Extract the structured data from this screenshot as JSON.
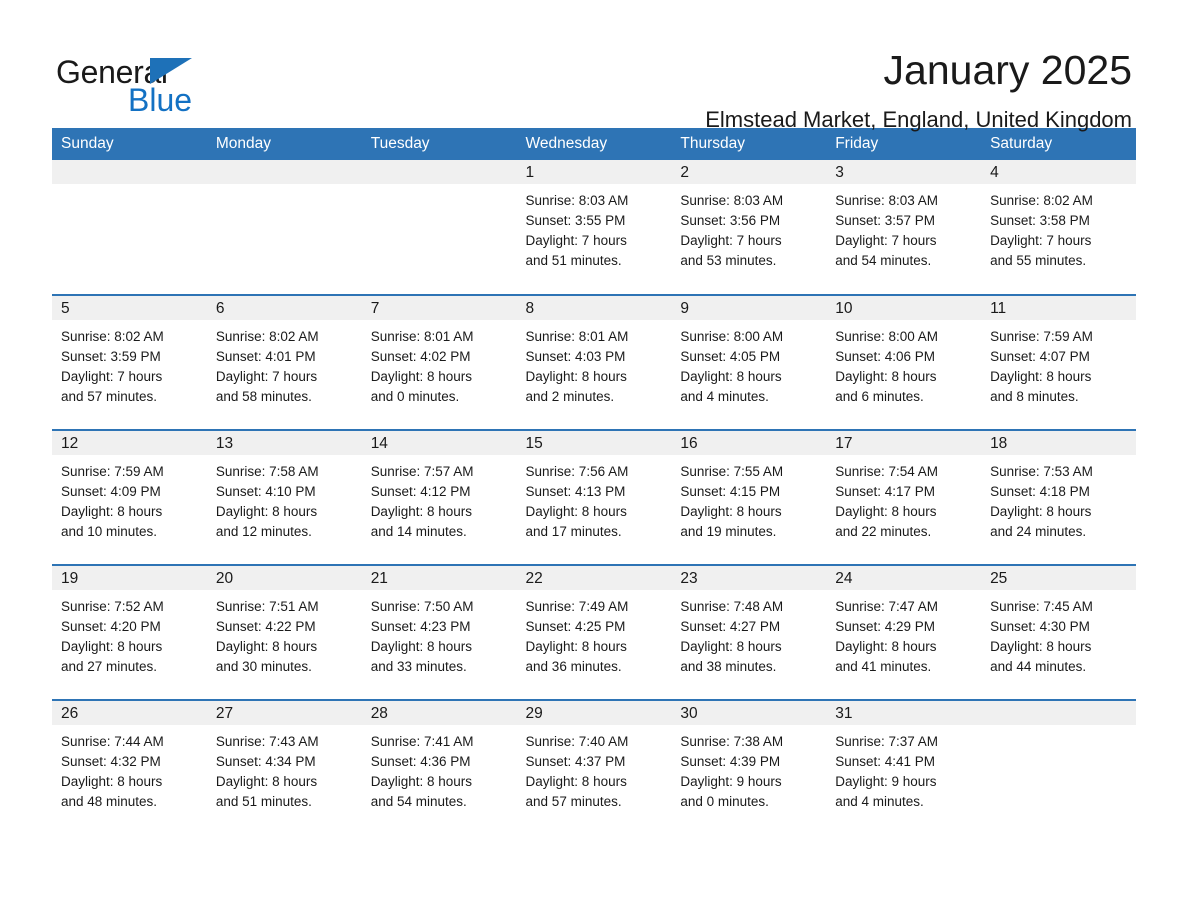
{
  "brand": {
    "name_part1": "General",
    "name_part2": "Blue",
    "triangle_icon": "triangle-icon",
    "accent_color": "#1371c3"
  },
  "header": {
    "title": "January 2025",
    "subtitle": "Elmstead Market, England, United Kingdom"
  },
  "theme": {
    "header_blue": "#2e74b5",
    "daynum_band": "#f0f0f0",
    "text": "#1a1a1a"
  },
  "calendar": {
    "columns": [
      "Sunday",
      "Monday",
      "Tuesday",
      "Wednesday",
      "Thursday",
      "Friday",
      "Saturday"
    ],
    "labels": {
      "sunrise": "Sunrise:",
      "sunset": "Sunset:",
      "daylight": "Daylight:"
    },
    "weeks": [
      [
        {
          "day": ""
        },
        {
          "day": ""
        },
        {
          "day": ""
        },
        {
          "day": "1",
          "sunrise": "Sunrise: 8:03 AM",
          "sunset": "Sunset: 3:55 PM",
          "daylight_line1": "Daylight: 7 hours",
          "daylight_line2": "and 51 minutes."
        },
        {
          "day": "2",
          "sunrise": "Sunrise: 8:03 AM",
          "sunset": "Sunset: 3:56 PM",
          "daylight_line1": "Daylight: 7 hours",
          "daylight_line2": "and 53 minutes."
        },
        {
          "day": "3",
          "sunrise": "Sunrise: 8:03 AM",
          "sunset": "Sunset: 3:57 PM",
          "daylight_line1": "Daylight: 7 hours",
          "daylight_line2": "and 54 minutes."
        },
        {
          "day": "4",
          "sunrise": "Sunrise: 8:02 AM",
          "sunset": "Sunset: 3:58 PM",
          "daylight_line1": "Daylight: 7 hours",
          "daylight_line2": "and 55 minutes."
        }
      ],
      [
        {
          "day": "5",
          "sunrise": "Sunrise: 8:02 AM",
          "sunset": "Sunset: 3:59 PM",
          "daylight_line1": "Daylight: 7 hours",
          "daylight_line2": "and 57 minutes."
        },
        {
          "day": "6",
          "sunrise": "Sunrise: 8:02 AM",
          "sunset": "Sunset: 4:01 PM",
          "daylight_line1": "Daylight: 7 hours",
          "daylight_line2": "and 58 minutes."
        },
        {
          "day": "7",
          "sunrise": "Sunrise: 8:01 AM",
          "sunset": "Sunset: 4:02 PM",
          "daylight_line1": "Daylight: 8 hours",
          "daylight_line2": "and 0 minutes."
        },
        {
          "day": "8",
          "sunrise": "Sunrise: 8:01 AM",
          "sunset": "Sunset: 4:03 PM",
          "daylight_line1": "Daylight: 8 hours",
          "daylight_line2": "and 2 minutes."
        },
        {
          "day": "9",
          "sunrise": "Sunrise: 8:00 AM",
          "sunset": "Sunset: 4:05 PM",
          "daylight_line1": "Daylight: 8 hours",
          "daylight_line2": "and 4 minutes."
        },
        {
          "day": "10",
          "sunrise": "Sunrise: 8:00 AM",
          "sunset": "Sunset: 4:06 PM",
          "daylight_line1": "Daylight: 8 hours",
          "daylight_line2": "and 6 minutes."
        },
        {
          "day": "11",
          "sunrise": "Sunrise: 7:59 AM",
          "sunset": "Sunset: 4:07 PM",
          "daylight_line1": "Daylight: 8 hours",
          "daylight_line2": "and 8 minutes."
        }
      ],
      [
        {
          "day": "12",
          "sunrise": "Sunrise: 7:59 AM",
          "sunset": "Sunset: 4:09 PM",
          "daylight_line1": "Daylight: 8 hours",
          "daylight_line2": "and 10 minutes."
        },
        {
          "day": "13",
          "sunrise": "Sunrise: 7:58 AM",
          "sunset": "Sunset: 4:10 PM",
          "daylight_line1": "Daylight: 8 hours",
          "daylight_line2": "and 12 minutes."
        },
        {
          "day": "14",
          "sunrise": "Sunrise: 7:57 AM",
          "sunset": "Sunset: 4:12 PM",
          "daylight_line1": "Daylight: 8 hours",
          "daylight_line2": "and 14 minutes."
        },
        {
          "day": "15",
          "sunrise": "Sunrise: 7:56 AM",
          "sunset": "Sunset: 4:13 PM",
          "daylight_line1": "Daylight: 8 hours",
          "daylight_line2": "and 17 minutes."
        },
        {
          "day": "16",
          "sunrise": "Sunrise: 7:55 AM",
          "sunset": "Sunset: 4:15 PM",
          "daylight_line1": "Daylight: 8 hours",
          "daylight_line2": "and 19 minutes."
        },
        {
          "day": "17",
          "sunrise": "Sunrise: 7:54 AM",
          "sunset": "Sunset: 4:17 PM",
          "daylight_line1": "Daylight: 8 hours",
          "daylight_line2": "and 22 minutes."
        },
        {
          "day": "18",
          "sunrise": "Sunrise: 7:53 AM",
          "sunset": "Sunset: 4:18 PM",
          "daylight_line1": "Daylight: 8 hours",
          "daylight_line2": "and 24 minutes."
        }
      ],
      [
        {
          "day": "19",
          "sunrise": "Sunrise: 7:52 AM",
          "sunset": "Sunset: 4:20 PM",
          "daylight_line1": "Daylight: 8 hours",
          "daylight_line2": "and 27 minutes."
        },
        {
          "day": "20",
          "sunrise": "Sunrise: 7:51 AM",
          "sunset": "Sunset: 4:22 PM",
          "daylight_line1": "Daylight: 8 hours",
          "daylight_line2": "and 30 minutes."
        },
        {
          "day": "21",
          "sunrise": "Sunrise: 7:50 AM",
          "sunset": "Sunset: 4:23 PM",
          "daylight_line1": "Daylight: 8 hours",
          "daylight_line2": "and 33 minutes."
        },
        {
          "day": "22",
          "sunrise": "Sunrise: 7:49 AM",
          "sunset": "Sunset: 4:25 PM",
          "daylight_line1": "Daylight: 8 hours",
          "daylight_line2": "and 36 minutes."
        },
        {
          "day": "23",
          "sunrise": "Sunrise: 7:48 AM",
          "sunset": "Sunset: 4:27 PM",
          "daylight_line1": "Daylight: 8 hours",
          "daylight_line2": "and 38 minutes."
        },
        {
          "day": "24",
          "sunrise": "Sunrise: 7:47 AM",
          "sunset": "Sunset: 4:29 PM",
          "daylight_line1": "Daylight: 8 hours",
          "daylight_line2": "and 41 minutes."
        },
        {
          "day": "25",
          "sunrise": "Sunrise: 7:45 AM",
          "sunset": "Sunset: 4:30 PM",
          "daylight_line1": "Daylight: 8 hours",
          "daylight_line2": "and 44 minutes."
        }
      ],
      [
        {
          "day": "26",
          "sunrise": "Sunrise: 7:44 AM",
          "sunset": "Sunset: 4:32 PM",
          "daylight_line1": "Daylight: 8 hours",
          "daylight_line2": "and 48 minutes."
        },
        {
          "day": "27",
          "sunrise": "Sunrise: 7:43 AM",
          "sunset": "Sunset: 4:34 PM",
          "daylight_line1": "Daylight: 8 hours",
          "daylight_line2": "and 51 minutes."
        },
        {
          "day": "28",
          "sunrise": "Sunrise: 7:41 AM",
          "sunset": "Sunset: 4:36 PM",
          "daylight_line1": "Daylight: 8 hours",
          "daylight_line2": "and 54 minutes."
        },
        {
          "day": "29",
          "sunrise": "Sunrise: 7:40 AM",
          "sunset": "Sunset: 4:37 PM",
          "daylight_line1": "Daylight: 8 hours",
          "daylight_line2": "and 57 minutes."
        },
        {
          "day": "30",
          "sunrise": "Sunrise: 7:38 AM",
          "sunset": "Sunset: 4:39 PM",
          "daylight_line1": "Daylight: 9 hours",
          "daylight_line2": "and 0 minutes."
        },
        {
          "day": "31",
          "sunrise": "Sunrise: 7:37 AM",
          "sunset": "Sunset: 4:41 PM",
          "daylight_line1": "Daylight: 9 hours",
          "daylight_line2": "and 4 minutes."
        },
        {
          "day": ""
        }
      ]
    ]
  }
}
